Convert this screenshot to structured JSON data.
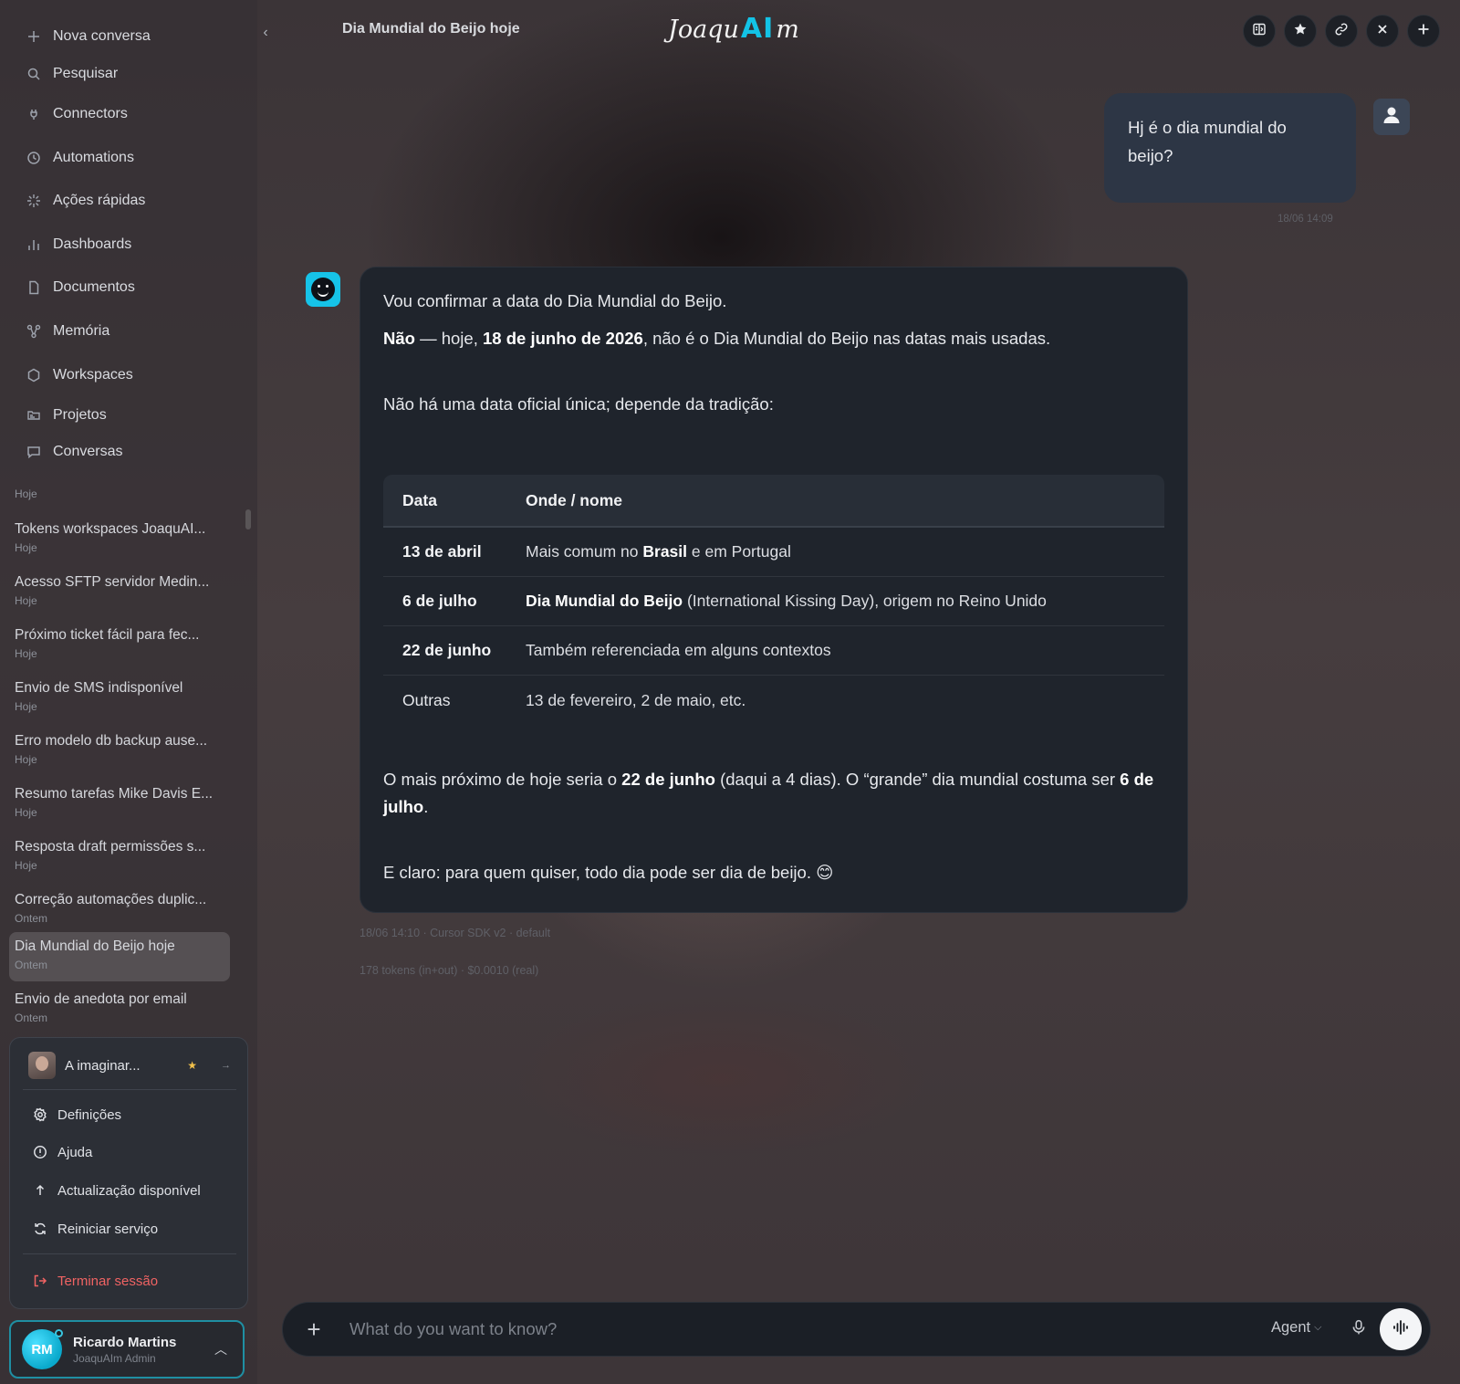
{
  "sidebar": {
    "nav": [
      {
        "label": "Nova conversa",
        "icon": "plus-icon"
      },
      {
        "label": "Pesquisar",
        "icon": "search-icon"
      },
      {
        "label": "Connectors",
        "icon": "plug-icon"
      },
      {
        "label": "Automations",
        "icon": "clock-icon"
      },
      {
        "label": "Ações rápidas",
        "icon": "sparkle-icon"
      },
      {
        "label": "Dashboards",
        "icon": "bar-chart-icon"
      },
      {
        "label": "Documentos",
        "icon": "document-icon"
      },
      {
        "label": "Memória",
        "icon": "graph-icon"
      },
      {
        "label": "Workspaces",
        "icon": "hexagon-icon"
      },
      {
        "label": "Projetos",
        "icon": "folder-icon"
      },
      {
        "label": "Conversas",
        "icon": "chat-icon"
      }
    ],
    "section_label": "Hoje",
    "conversations": [
      {
        "title": "Tokens workspaces JoaquAI...",
        "date": "Hoje"
      },
      {
        "title": "Acesso SFTP servidor Medin...",
        "date": "Hoje"
      },
      {
        "title": "Próximo ticket fácil para fec...",
        "date": "Hoje"
      },
      {
        "title": "Envio de SMS indisponível",
        "date": "Hoje"
      },
      {
        "title": "Erro modelo db backup ause...",
        "date": "Hoje"
      },
      {
        "title": "Resumo tarefas Mike Davis E...",
        "date": "Hoje"
      },
      {
        "title": "Resposta draft permissões s...",
        "date": "Hoje"
      },
      {
        "title": "Correção automações duplic...",
        "date": "Ontem"
      },
      {
        "title": "Dia Mundial do Beijo hoje",
        "date": "Ontem",
        "active": true
      },
      {
        "title": "Envio de anedota por email",
        "date": "Ontem"
      }
    ]
  },
  "menu": {
    "status": "A imaginar...",
    "items": [
      {
        "label": "Definições",
        "icon": "settings-icon"
      },
      {
        "label": "Ajuda",
        "icon": "help-icon"
      },
      {
        "label": "Actualização disponível",
        "icon": "arrow-up-icon"
      },
      {
        "label": "Reiniciar serviço",
        "icon": "restart-icon"
      }
    ],
    "logout": "Terminar sessão"
  },
  "user": {
    "initials": "RM",
    "name": "Ricardo Martins",
    "role": "JoaquAIm Admin"
  },
  "header": {
    "title": "Dia Mundial do Beijo hoje",
    "logo": {
      "part1": "Joaqu",
      "part2": "AI",
      "part3": "m"
    },
    "buttons": [
      "split-view-icon",
      "star-icon",
      "link-icon",
      "close-icon",
      "plus-icon"
    ]
  },
  "chat": {
    "user_message": "Hj é o dia mundial do beijo?",
    "user_time": "18/06 14:09",
    "bot": {
      "intro": "Vou confirmar a data do Dia Mundial do Beijo.",
      "answer_b1": "Não",
      "answer_t1": " — hoje, ",
      "answer_b2": "18 de junho de 2026",
      "answer_t2": ", não é o Dia Mundial do Beijo nas datas mais usadas.",
      "context": "Não há uma data oficial única; depende da tradição:",
      "table": {
        "headers": [
          "Data",
          "Onde / nome"
        ],
        "rows": [
          {
            "date": "13 de abril",
            "pre": "Mais comum no ",
            "bold": "Brasil",
            "post": " e em Portugal",
            "date_bold": true
          },
          {
            "date": "6 de julho",
            "pre": "",
            "bold": "Dia Mundial do Beijo",
            "post": " (International Kissing Day), origem no Reino Unido",
            "date_bold": true
          },
          {
            "date": "22 de junho",
            "pre": "Também referenciada em alguns contextos",
            "bold": "",
            "post": "",
            "date_bold": true
          },
          {
            "date": "Outras",
            "pre": "13 de fevereiro, 2 de maio, etc.",
            "bold": "",
            "post": "",
            "date_bold": false
          }
        ]
      },
      "closest_t1": "O mais próximo de hoje seria o ",
      "closest_b1": "22 de junho",
      "closest_t2": " (daqui a 4 dias). O “grande” dia mundial costuma ser ",
      "closest_b2": "6 de julho",
      "closest_t3": ".",
      "closing": "E claro: para quem quiser, todo dia pode ser dia de beijo. 😊"
    },
    "meta_line1": "18/06 14:10 · Cursor SDK v2 · default",
    "meta_line2": "178 tokens (in+out) · $0.0010 (real)"
  },
  "composer": {
    "placeholder": "What do you want to know?",
    "mode": "Agent"
  },
  "colors": {
    "accent": "#13c3e6",
    "danger": "#f06363",
    "star": "#f2c14b"
  }
}
